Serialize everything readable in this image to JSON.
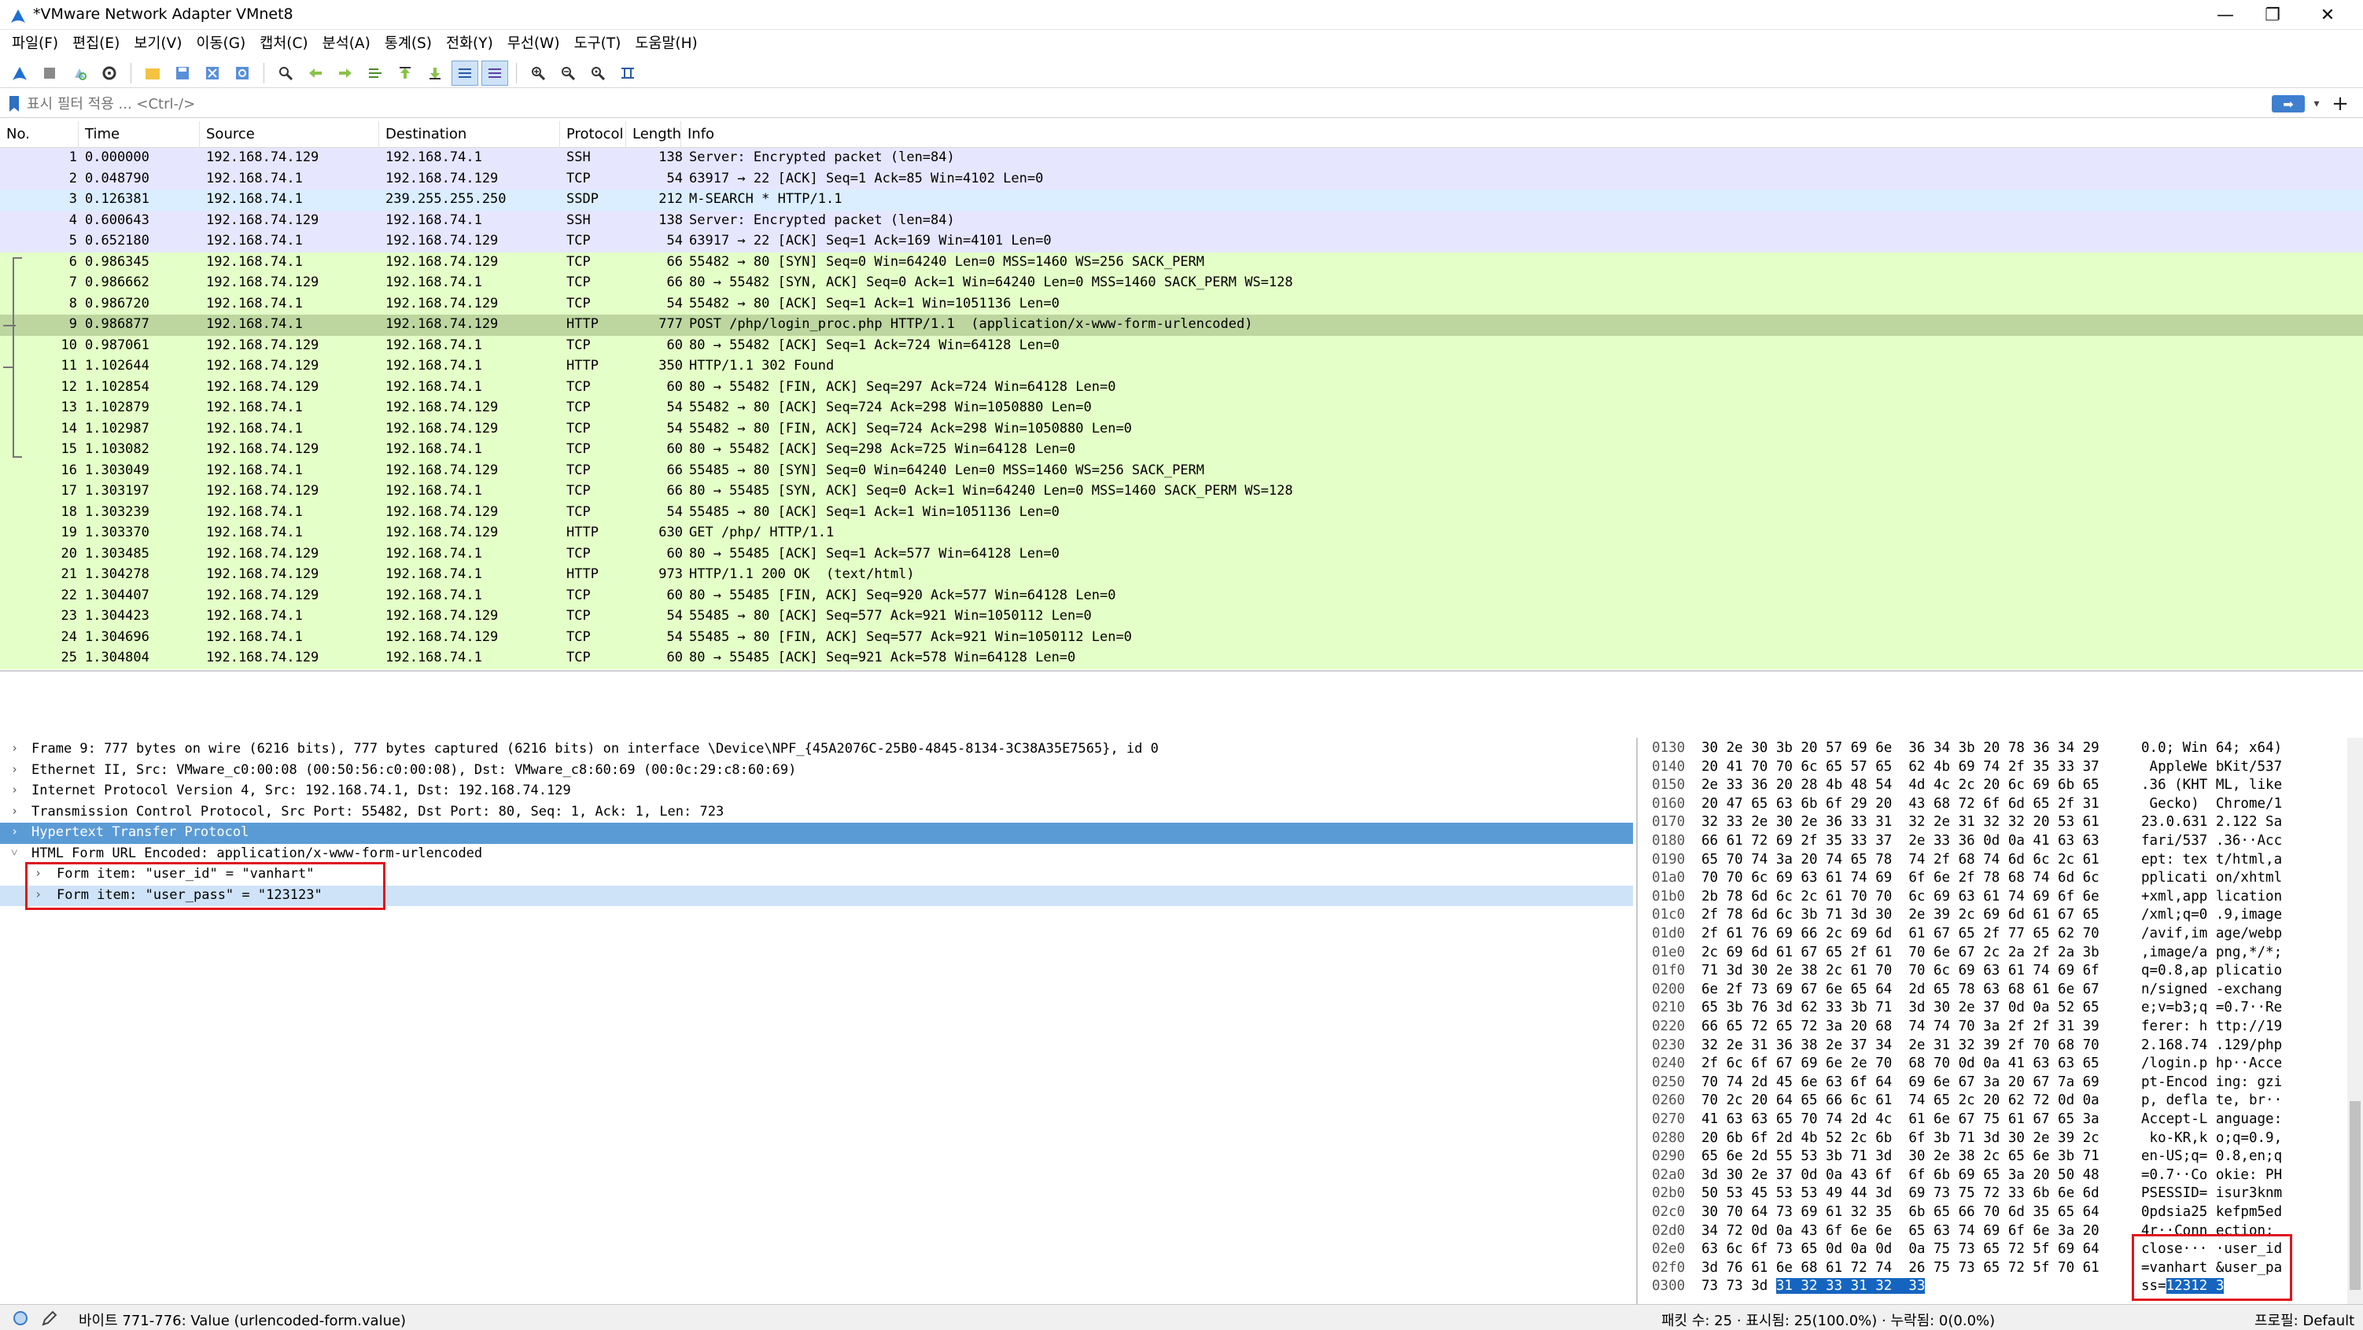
{
  "window": {
    "title": "*VMware Network Adapter VMnet8",
    "minimize": "—",
    "maximize": "❐",
    "close": "✕"
  },
  "menu": [
    "파일(F)",
    "편집(E)",
    "보기(V)",
    "이동(G)",
    "캡처(C)",
    "분석(A)",
    "통계(S)",
    "전화(Y)",
    "무선(W)",
    "도구(T)",
    "도움말(H)"
  ],
  "filter": {
    "placeholder": "표시 필터 적용 ... <Ctrl-/>",
    "apply_icon": "arrow-right-icon"
  },
  "packet_columns": [
    "No.",
    "Time",
    "Source",
    "Destination",
    "Protocol",
    "Length",
    "Info"
  ],
  "colors": {
    "ssh_row": "#e7e6ff",
    "tcp_row": "#e4ffc7",
    "ssdp_row": "#daeeff",
    "selected_row": "#bdd6a0",
    "highlight": "#1565c0",
    "selected_detail": "#5b9bd5",
    "red_box": "#e0141e"
  },
  "packets": [
    {
      "no": "1",
      "time": "0.000000",
      "src": "192.168.74.129",
      "dst": "192.168.74.1",
      "proto": "SSH",
      "len": "138",
      "info": "Server: Encrypted packet (len=84)",
      "color": "ssh"
    },
    {
      "no": "2",
      "time": "0.048790",
      "src": "192.168.74.1",
      "dst": "192.168.74.129",
      "proto": "TCP",
      "len": "54",
      "info": "63917 → 22 [ACK] Seq=1 Ack=85 Win=4102 Len=0",
      "color": "ssh"
    },
    {
      "no": "3",
      "time": "0.126381",
      "src": "192.168.74.1",
      "dst": "239.255.255.250",
      "proto": "SSDP",
      "len": "212",
      "info": "M-SEARCH * HTTP/1.1",
      "color": "ssdp"
    },
    {
      "no": "4",
      "time": "0.600643",
      "src": "192.168.74.129",
      "dst": "192.168.74.1",
      "proto": "SSH",
      "len": "138",
      "info": "Server: Encrypted packet (len=84)",
      "color": "ssh"
    },
    {
      "no": "5",
      "time": "0.652180",
      "src": "192.168.74.1",
      "dst": "192.168.74.129",
      "proto": "TCP",
      "len": "54",
      "info": "63917 → 22 [ACK] Seq=1 Ack=169 Win=4101 Len=0",
      "color": "ssh"
    },
    {
      "no": "6",
      "time": "0.986345",
      "src": "192.168.74.1",
      "dst": "192.168.74.129",
      "proto": "TCP",
      "len": "66",
      "info": "55482 → 80 [SYN] Seq=0 Win=64240 Len=0 MSS=1460 WS=256 SACK_PERM",
      "color": "tcp"
    },
    {
      "no": "7",
      "time": "0.986662",
      "src": "192.168.74.129",
      "dst": "192.168.74.1",
      "proto": "TCP",
      "len": "66",
      "info": "80 → 55482 [SYN, ACK] Seq=0 Ack=1 Win=64240 Len=0 MSS=1460 SACK_PERM WS=128",
      "color": "tcp"
    },
    {
      "no": "8",
      "time": "0.986720",
      "src": "192.168.74.1",
      "dst": "192.168.74.129",
      "proto": "TCP",
      "len": "54",
      "info": "55482 → 80 [ACK] Seq=1 Ack=1 Win=1051136 Len=0",
      "color": "tcp"
    },
    {
      "no": "9",
      "time": "0.986877",
      "src": "192.168.74.1",
      "dst": "192.168.74.129",
      "proto": "HTTP",
      "len": "777",
      "info": "POST /php/login_proc.php HTTP/1.1  (application/x-www-form-urlencoded)",
      "color": "selected"
    },
    {
      "no": "10",
      "time": "0.987061",
      "src": "192.168.74.129",
      "dst": "192.168.74.1",
      "proto": "TCP",
      "len": "60",
      "info": "80 → 55482 [ACK] Seq=1 Ack=724 Win=64128 Len=0",
      "color": "tcp"
    },
    {
      "no": "11",
      "time": "1.102644",
      "src": "192.168.74.129",
      "dst": "192.168.74.1",
      "proto": "HTTP",
      "len": "350",
      "info": "HTTP/1.1 302 Found",
      "color": "tcp"
    },
    {
      "no": "12",
      "time": "1.102854",
      "src": "192.168.74.129",
      "dst": "192.168.74.1",
      "proto": "TCP",
      "len": "60",
      "info": "80 → 55482 [FIN, ACK] Seq=297 Ack=724 Win=64128 Len=0",
      "color": "tcp"
    },
    {
      "no": "13",
      "time": "1.102879",
      "src": "192.168.74.1",
      "dst": "192.168.74.129",
      "proto": "TCP",
      "len": "54",
      "info": "55482 → 80 [ACK] Seq=724 Ack=298 Win=1050880 Len=0",
      "color": "tcp"
    },
    {
      "no": "14",
      "time": "1.102987",
      "src": "192.168.74.1",
      "dst": "192.168.74.129",
      "proto": "TCP",
      "len": "54",
      "info": "55482 → 80 [FIN, ACK] Seq=724 Ack=298 Win=1050880 Len=0",
      "color": "tcp"
    },
    {
      "no": "15",
      "time": "1.103082",
      "src": "192.168.74.129",
      "dst": "192.168.74.1",
      "proto": "TCP",
      "len": "60",
      "info": "80 → 55482 [ACK] Seq=298 Ack=725 Win=64128 Len=0",
      "color": "tcp"
    },
    {
      "no": "16",
      "time": "1.303049",
      "src": "192.168.74.1",
      "dst": "192.168.74.129",
      "proto": "TCP",
      "len": "66",
      "info": "55485 → 80 [SYN] Seq=0 Win=64240 Len=0 MSS=1460 WS=256 SACK_PERM",
      "color": "tcp"
    },
    {
      "no": "17",
      "time": "1.303197",
      "src": "192.168.74.129",
      "dst": "192.168.74.1",
      "proto": "TCP",
      "len": "66",
      "info": "80 → 55485 [SYN, ACK] Seq=0 Ack=1 Win=64240 Len=0 MSS=1460 SACK_PERM WS=128",
      "color": "tcp"
    },
    {
      "no": "18",
      "time": "1.303239",
      "src": "192.168.74.1",
      "dst": "192.168.74.129",
      "proto": "TCP",
      "len": "54",
      "info": "55485 → 80 [ACK] Seq=1 Ack=1 Win=1051136 Len=0",
      "color": "tcp"
    },
    {
      "no": "19",
      "time": "1.303370",
      "src": "192.168.74.1",
      "dst": "192.168.74.129",
      "proto": "HTTP",
      "len": "630",
      "info": "GET /php/ HTTP/1.1",
      "color": "tcp"
    },
    {
      "no": "20",
      "time": "1.303485",
      "src": "192.168.74.129",
      "dst": "192.168.74.1",
      "proto": "TCP",
      "len": "60",
      "info": "80 → 55485 [ACK] Seq=1 Ack=577 Win=64128 Len=0",
      "color": "tcp"
    },
    {
      "no": "21",
      "time": "1.304278",
      "src": "192.168.74.129",
      "dst": "192.168.74.1",
      "proto": "HTTP",
      "len": "973",
      "info": "HTTP/1.1 200 OK  (text/html)",
      "color": "tcp"
    },
    {
      "no": "22",
      "time": "1.304407",
      "src": "192.168.74.129",
      "dst": "192.168.74.1",
      "proto": "TCP",
      "len": "60",
      "info": "80 → 55485 [FIN, ACK] Seq=920 Ack=577 Win=64128 Len=0",
      "color": "tcp"
    },
    {
      "no": "23",
      "time": "1.304423",
      "src": "192.168.74.1",
      "dst": "192.168.74.129",
      "proto": "TCP",
      "len": "54",
      "info": "55485 → 80 [ACK] Seq=577 Ack=921 Win=1050112 Len=0",
      "color": "tcp"
    },
    {
      "no": "24",
      "time": "1.304696",
      "src": "192.168.74.1",
      "dst": "192.168.74.129",
      "proto": "TCP",
      "len": "54",
      "info": "55485 → 80 [FIN, ACK] Seq=577 Ack=921 Win=1050112 Len=0",
      "color": "tcp"
    },
    {
      "no": "25",
      "time": "1.304804",
      "src": "192.168.74.129",
      "dst": "192.168.74.1",
      "proto": "TCP",
      "len": "60",
      "info": "80 → 55485 [ACK] Seq=921 Ack=578 Win=64128 Len=0",
      "color": "tcp"
    }
  ],
  "details": [
    {
      "text": "Frame 9: 777 bytes on wire (6216 bits), 777 bytes captured (6216 bits) on interface \\Device\\NPF_{45A2076C-25B0-4845-8134-3C38A35E7565}, id 0",
      "arrow": "›",
      "indent": 0,
      "state": "normal"
    },
    {
      "text": "Ethernet II, Src: VMware_c0:00:08 (00:50:56:c0:00:08), Dst: VMware_c8:60:69 (00:0c:29:c8:60:69)",
      "arrow": "›",
      "indent": 0,
      "state": "normal"
    },
    {
      "text": "Internet Protocol Version 4, Src: 192.168.74.1, Dst: 192.168.74.129",
      "arrow": "›",
      "indent": 0,
      "state": "normal"
    },
    {
      "text": "Transmission Control Protocol, Src Port: 55482, Dst Port: 80, Seq: 1, Ack: 1, Len: 723",
      "arrow": "›",
      "indent": 0,
      "state": "normal"
    },
    {
      "text": "Hypertext Transfer Protocol",
      "arrow": "›",
      "indent": 0,
      "state": "selected"
    },
    {
      "text": "HTML Form URL Encoded: application/x-www-form-urlencoded",
      "arrow": "˅",
      "indent": 0,
      "state": "normal"
    },
    {
      "text": "Form item: \"user_id\" = \"vanhart\"",
      "arrow": "›",
      "indent": 1,
      "state": "normal"
    },
    {
      "text": "Form item: \"user_pass\" = \"123123\"",
      "arrow": "›",
      "indent": 1,
      "state": "related"
    }
  ],
  "bytes": [
    {
      "off": "0130",
      "hex": "30 2e 30 3b 20 57 69 6e  36 34 3b 20 78 36 34 29",
      "asc": "0.0; Win 64; x64)"
    },
    {
      "off": "0140",
      "hex": "20 41 70 70 6c 65 57 65  62 4b 69 74 2f 35 33 37",
      "asc": " AppleWe bKit/537"
    },
    {
      "off": "0150",
      "hex": "2e 33 36 20 28 4b 48 54  4d 4c 2c 20 6c 69 6b 65",
      "asc": ".36 (KHT ML, like"
    },
    {
      "off": "0160",
      "hex": "20 47 65 63 6b 6f 29 20  43 68 72 6f 6d 65 2f 31",
      "asc": " Gecko)  Chrome/1"
    },
    {
      "off": "0170",
      "hex": "32 33 2e 30 2e 36 33 31  32 2e 31 32 32 20 53 61",
      "asc": "23.0.631 2.122 Sa"
    },
    {
      "off": "0180",
      "hex": "66 61 72 69 2f 35 33 37  2e 33 36 0d 0a 41 63 63",
      "asc": "fari/537 .36··Acc"
    },
    {
      "off": "0190",
      "hex": "65 70 74 3a 20 74 65 78  74 2f 68 74 6d 6c 2c 61",
      "asc": "ept: tex t/html,a"
    },
    {
      "off": "01a0",
      "hex": "70 70 6c 69 63 61 74 69  6f 6e 2f 78 68 74 6d 6c",
      "asc": "pplicati on/xhtml"
    },
    {
      "off": "01b0",
      "hex": "2b 78 6d 6c 2c 61 70 70  6c 69 63 61 74 69 6f 6e",
      "asc": "+xml,app lication"
    },
    {
      "off": "01c0",
      "hex": "2f 78 6d 6c 3b 71 3d 30  2e 39 2c 69 6d 61 67 65",
      "asc": "/xml;q=0 .9,image"
    },
    {
      "off": "01d0",
      "hex": "2f 61 76 69 66 2c 69 6d  61 67 65 2f 77 65 62 70",
      "asc": "/avif,im age/webp"
    },
    {
      "off": "01e0",
      "hex": "2c 69 6d 61 67 65 2f 61  70 6e 67 2c 2a 2f 2a 3b",
      "asc": ",image/a png,*/*;"
    },
    {
      "off": "01f0",
      "hex": "71 3d 30 2e 38 2c 61 70  70 6c 69 63 61 74 69 6f",
      "asc": "q=0.8,ap plicatio"
    },
    {
      "off": "0200",
      "hex": "6e 2f 73 69 67 6e 65 64  2d 65 78 63 68 61 6e 67",
      "asc": "n/signed -exchang"
    },
    {
      "off": "0210",
      "hex": "65 3b 76 3d 62 33 3b 71  3d 30 2e 37 0d 0a 52 65",
      "asc": "e;v=b3;q =0.7··Re"
    },
    {
      "off": "0220",
      "hex": "66 65 72 65 72 3a 20 68  74 74 70 3a 2f 2f 31 39",
      "asc": "ferer: h ttp://19"
    },
    {
      "off": "0230",
      "hex": "32 2e 31 36 38 2e 37 34  2e 31 32 39 2f 70 68 70",
      "asc": "2.168.74 .129/php"
    },
    {
      "off": "0240",
      "hex": "2f 6c 6f 67 69 6e 2e 70  68 70 0d 0a 41 63 63 65",
      "asc": "/login.p hp··Acce"
    },
    {
      "off": "0250",
      "hex": "70 74 2d 45 6e 63 6f 64  69 6e 67 3a 20 67 7a 69",
      "asc": "pt-Encod ing: gzi"
    },
    {
      "off": "0260",
      "hex": "70 2c 20 64 65 66 6c 61  74 65 2c 20 62 72 0d 0a",
      "asc": "p, defla te, br··"
    },
    {
      "off": "0270",
      "hex": "41 63 63 65 70 74 2d 4c  61 6e 67 75 61 67 65 3a",
      "asc": "Accept-L anguage:"
    },
    {
      "off": "0280",
      "hex": "20 6b 6f 2d 4b 52 2c 6b  6f 3b 71 3d 30 2e 39 2c",
      "asc": " ko-KR,k o;q=0.9,"
    },
    {
      "off": "0290",
      "hex": "65 6e 2d 55 53 3b 71 3d  30 2e 38 2c 65 6e 3b 71",
      "asc": "en-US;q= 0.8,en;q"
    },
    {
      "off": "02a0",
      "hex": "3d 30 2e 37 0d 0a 43 6f  6f 6b 69 65 3a 20 50 48",
      "asc": "=0.7··Co okie: PH"
    },
    {
      "off": "02b0",
      "hex": "50 53 45 53 53 49 44 3d  69 73 75 72 33 6b 6e 6d",
      "asc": "PSESSID= isur3knm"
    },
    {
      "off": "02c0",
      "hex": "30 70 64 73 69 61 32 35  6b 65 66 70 6d 35 65 64",
      "asc": "0pdsia25 kefpm5ed"
    },
    {
      "off": "02d0",
      "hex": "34 72 0d 0a 43 6f 6e 6e  65 63 74 69 6f 6e 3a 20",
      "asc": "4r··Conn ection: "
    },
    {
      "off": "02e0",
      "hex": "63 6c 6f 73 65 0d 0a 0d  0a 75 73 65 72 5f 69 64",
      "asc": "close··· ·user_id"
    },
    {
      "off": "02f0",
      "hex": "3d 76 61 6e 68 61 72 74  26 75 73 65 72 5f 70 61",
      "asc": "=vanhart &user_pa"
    },
    {
      "off": "0300",
      "hex_plain": "73 73 3d ",
      "hex_hl": "31 32 33 31 32  33",
      "asc_plain": "ss=",
      "asc_hl": "12312 3"
    }
  ],
  "status": {
    "bytes_info": "바이트 771-776: Value (urlencoded-form.value)",
    "packet_info": "패킷 수: 25 · 표시됨: 25(100.0%) · 누락됨: 0(0.0%)",
    "profile": "프로필: Default"
  }
}
